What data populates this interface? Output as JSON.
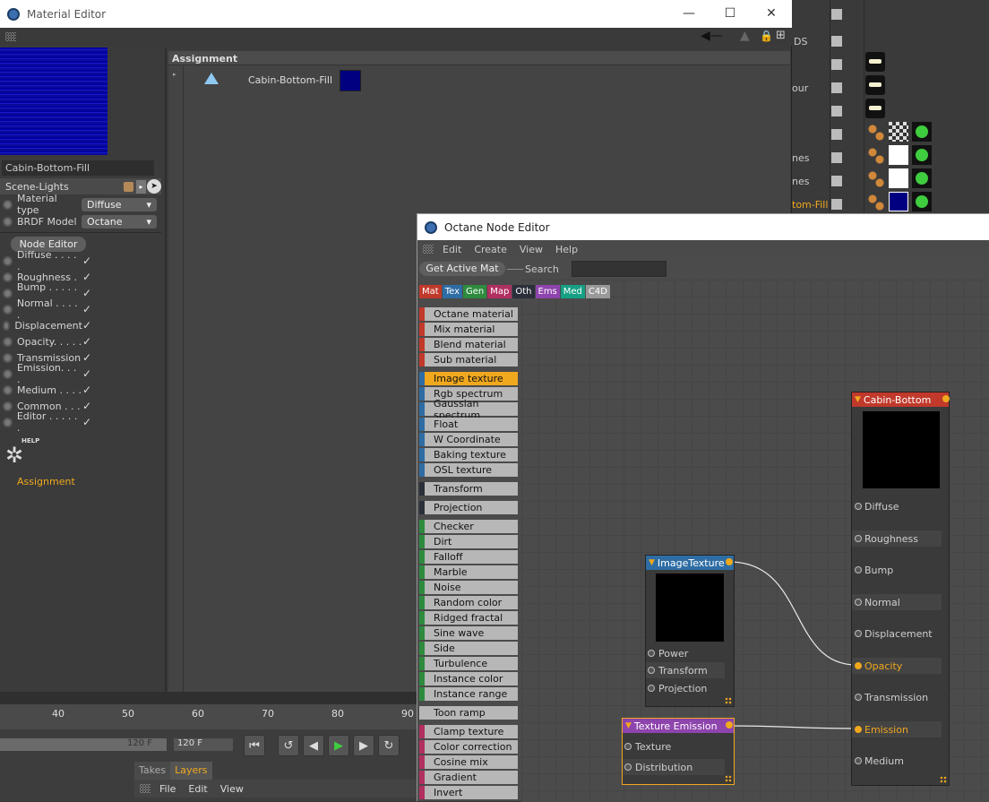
{
  "material_editor": {
    "title": "Material Editor",
    "assignment_header": "Assignment",
    "assignment_item": "Cabin-Bottom-Fill",
    "material_name": "Cabin-Bottom-Fill",
    "scene_lights": "Scene-Lights",
    "material_type_label": "Material type",
    "material_type_value": "Diffuse",
    "brdf_label": "BRDF Model",
    "brdf_value": "Octane",
    "node_editor_button": "Node Editor",
    "channels": [
      {
        "label": "Diffuse . . . . ."
      },
      {
        "label": "Roughness ."
      },
      {
        "label": "Bump . . . . . ."
      },
      {
        "label": "Normal . . . . ."
      },
      {
        "label": "Displacement"
      },
      {
        "label": "Opacity. . . . ."
      },
      {
        "label": "Transmission"
      },
      {
        "label": "Emission. . . ."
      },
      {
        "label": "Medium . . . ."
      },
      {
        "label": "Common . . ."
      },
      {
        "label": "Editor . . . . . ."
      }
    ],
    "checkmark": "✓",
    "help_label": "HELP",
    "assignment_link": "Assignment",
    "swatch_color": "#000080"
  },
  "object_manager": {
    "rows": [
      "DS",
      "our",
      "nes",
      "nes",
      "tom-Fill"
    ]
  },
  "timeline": {
    "ticks": [
      "40",
      "50",
      "60",
      "70",
      "80",
      "90"
    ],
    "frame_left": "120 F",
    "frame_right": "120 F",
    "tabs": [
      "Takes",
      "Layers"
    ],
    "menu": [
      "File",
      "Edit",
      "View"
    ]
  },
  "node_editor": {
    "title": "Octane Node Editor",
    "menu": [
      "Edit",
      "Create",
      "View",
      "Help"
    ],
    "get_active_mat": "Get Active Mat",
    "search_label": "Search",
    "search_value": "",
    "categories": [
      {
        "label": "Mat",
        "color": "#c0392b"
      },
      {
        "label": "Tex",
        "color": "#2e6da4"
      },
      {
        "label": "Gen",
        "color": "#2e8b3e"
      },
      {
        "label": "Map",
        "color": "#b03060"
      },
      {
        "label": "Oth",
        "color": "#2a2f3a"
      },
      {
        "label": "Ems",
        "color": "#8e44ad"
      },
      {
        "label": "Med",
        "color": "#16a085"
      },
      {
        "label": "C4D",
        "color": "#888888"
      }
    ],
    "library": [
      "Octane material",
      "Mix material",
      "Blend material",
      "Sub material",
      "Image texture",
      "Rgb spectrum",
      "Gaussian spectrum",
      "Float",
      "W Coordinate",
      "Baking texture",
      "OSL texture",
      "Transform",
      "Projection",
      "Checker",
      "Dirt",
      "Falloff",
      "Marble",
      "Noise",
      "Random color",
      "Ridged fractal",
      "Sine wave",
      "Side",
      "Turbulence",
      "Instance color",
      "Instance range",
      "Toon ramp",
      "Clamp texture",
      "Color correction",
      "Cosine mix",
      "Gradient",
      "Invert"
    ],
    "nodes": {
      "material": {
        "title": "Cabin-Bottom",
        "header_color": "#c0392b",
        "ports": [
          "Diffuse",
          "Roughness",
          "Bump",
          "Normal",
          "Displacement",
          "Opacity",
          "Transmission",
          "Emission",
          "Medium"
        ]
      },
      "image_texture": {
        "title": "ImageTexture",
        "header_color": "#2e6da4",
        "ports": [
          "Power",
          "Transform",
          "Projection"
        ]
      },
      "texture_emission": {
        "title": "Texture Emission",
        "header_color": "#8e44ad",
        "ports": [
          "Texture",
          "Distribution"
        ]
      }
    }
  }
}
